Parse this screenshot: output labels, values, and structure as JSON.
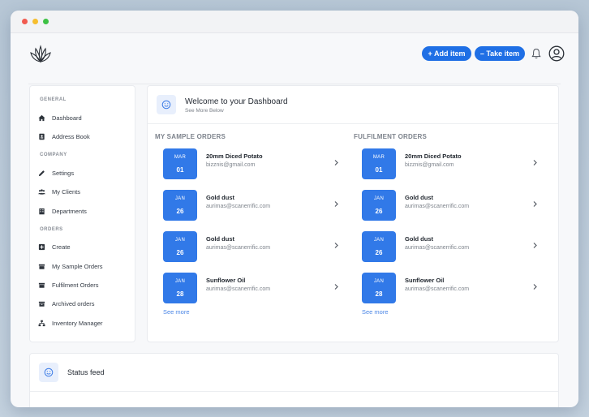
{
  "topbar": {
    "add_item_label": "+ Add item",
    "take_item_label": "– Take item"
  },
  "sidebar": {
    "sections": [
      {
        "title": "GENERAL",
        "items": [
          {
            "label": "Dashboard",
            "icon": "home-icon"
          },
          {
            "label": "Address Book",
            "icon": "address-book-icon"
          }
        ]
      },
      {
        "title": "COMPANY",
        "items": [
          {
            "label": "Settings",
            "icon": "pencil-icon"
          },
          {
            "label": "My Clients",
            "icon": "users-icon"
          },
          {
            "label": "Departments",
            "icon": "building-icon"
          }
        ]
      },
      {
        "title": "ORDERS",
        "items": [
          {
            "label": "Create",
            "icon": "plus-square-icon"
          },
          {
            "label": "My Sample Orders",
            "icon": "box-icon"
          },
          {
            "label": "Fulfilment Orders",
            "icon": "box-icon"
          },
          {
            "label": "Archived orders",
            "icon": "archive-icon"
          },
          {
            "label": "Inventory Manager",
            "icon": "sitemap-icon"
          }
        ]
      }
    ]
  },
  "welcome": {
    "title": "Welcome to your Dashboard",
    "subtitle": "See More Below"
  },
  "sample_orders": {
    "title": "MY SAMPLE ORDERS",
    "see_more": "See more",
    "orders": [
      {
        "month": "MAR",
        "day": "01",
        "name": "20mm Diced Potato",
        "email": "bizznis@gmail.com"
      },
      {
        "month": "JAN",
        "day": "26",
        "name": "Gold dust",
        "email": "aurimas@scanerrific.com"
      },
      {
        "month": "JAN",
        "day": "26",
        "name": "Gold dust",
        "email": "aurimas@scanerrific.com"
      },
      {
        "month": "JAN",
        "day": "28",
        "name": "Sunflower Oil",
        "email": "aurimas@scanerrific.com"
      }
    ]
  },
  "fulfilment_orders": {
    "title": "FULFILMENT ORDERS",
    "see_more": "See more",
    "orders": [
      {
        "month": "MAR",
        "day": "01",
        "name": "20mm Diced Potato",
        "email": "bizznis@gmail.com"
      },
      {
        "month": "JAN",
        "day": "26",
        "name": "Gold dust",
        "email": "aurimas@scanerrific.com"
      },
      {
        "month": "JAN",
        "day": "26",
        "name": "Gold dust",
        "email": "aurimas@scanerrific.com"
      },
      {
        "month": "JAN",
        "day": "28",
        "name": "Sunflower Oil",
        "email": "aurimas@scanerrific.com"
      }
    ]
  },
  "status_feed": {
    "title": "Status feed"
  },
  "colors": {
    "accent": "#1f6fe5",
    "badge": "#3179e8",
    "link": "#4b86e6"
  }
}
